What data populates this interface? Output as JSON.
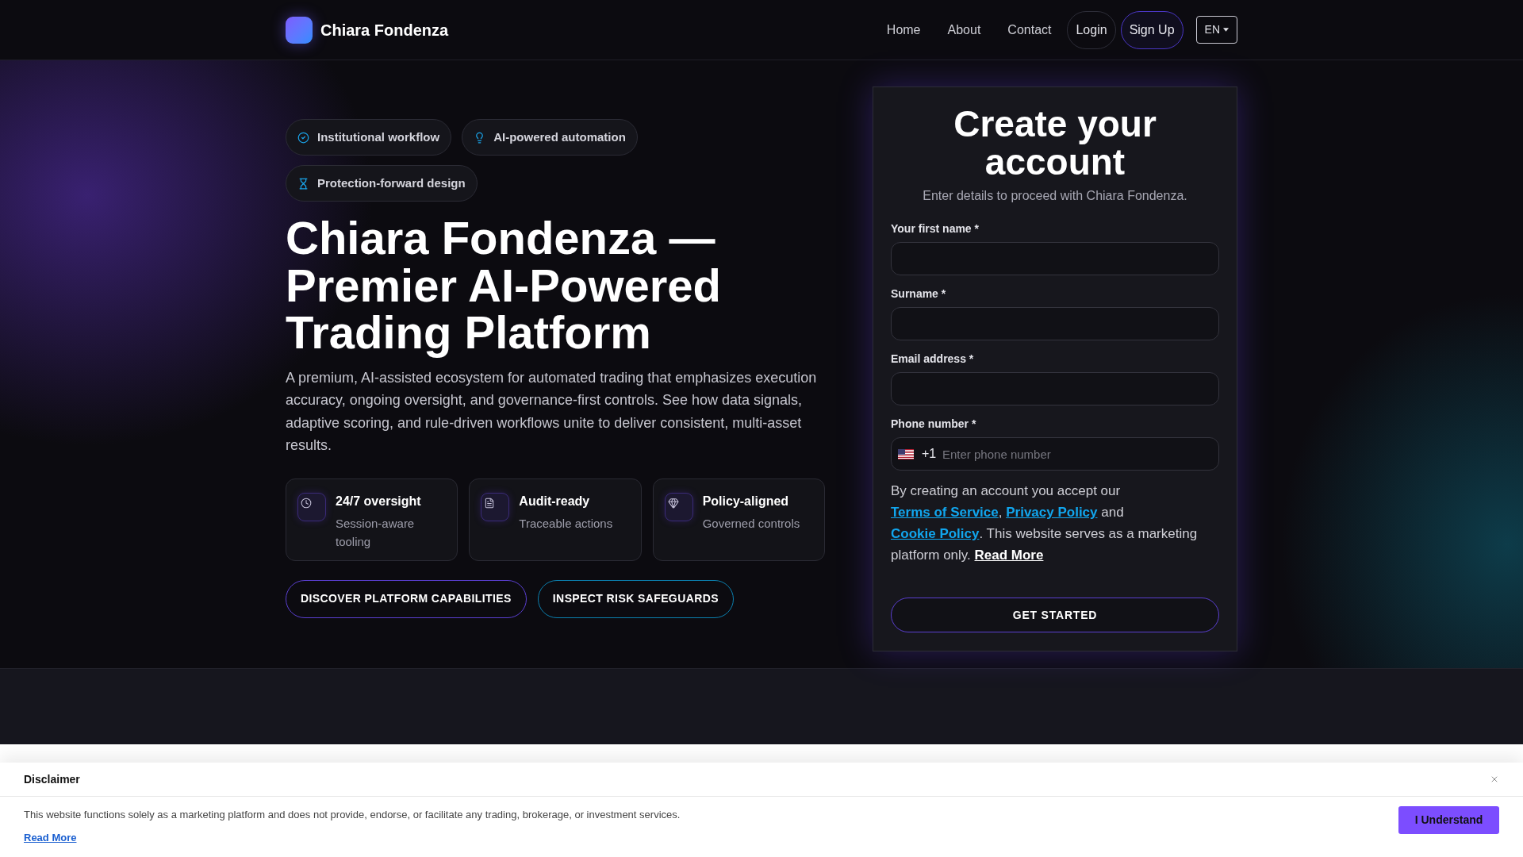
{
  "header": {
    "brand": "Chiara Fondenza",
    "nav": [
      {
        "kind": "link",
        "label": "Home"
      },
      {
        "kind": "link",
        "label": "About"
      },
      {
        "kind": "link",
        "label": "Contact"
      },
      {
        "kind": "outline",
        "label": "Login"
      },
      {
        "kind": "accent",
        "label": "Sign Up"
      }
    ],
    "language": "EN"
  },
  "hero": {
    "badges": [
      "Institutional workflow",
      "AI-powered automation",
      "Protection-forward design"
    ],
    "title": "Chiara Fondenza — Premier AI-Powered Trading Platform",
    "description": "A premium, AI-assisted ecosystem for automated trading that emphasizes execution accuracy, ongoing oversight, and governance-first controls. See how data signals, adaptive scoring, and rule-driven workflows unite to deliver consistent, multi-asset results.",
    "features": [
      {
        "title": "24/7 oversight",
        "text": "Session-aware tooling"
      },
      {
        "title": "Audit-ready",
        "text": "Traceable actions"
      },
      {
        "title": "Policy-aligned",
        "text": "Governed controls"
      }
    ],
    "actions": [
      {
        "kind": "primary",
        "label": "DISCOVER PLATFORM CAPABILITIES"
      },
      {
        "kind": "secondary",
        "label": "INSPECT RISK SAFEGUARDS"
      }
    ]
  },
  "signup": {
    "title": "Create your account",
    "subtitle": "Enter details to proceed with Chiara Fondenza.",
    "fields": [
      {
        "kind": "text",
        "label": "Your first name *"
      },
      {
        "kind": "text",
        "label": "Surname *"
      },
      {
        "kind": "email",
        "label": "Email address *"
      },
      {
        "kind": "phone",
        "label": "Phone number *",
        "dial_code": "+1",
        "placeholder": "Enter phone number"
      }
    ],
    "consent": [
      {
        "kind": "text",
        "text": "By creating an account you accept our "
      },
      {
        "kind": "link",
        "text": "Terms of Service"
      },
      {
        "kind": "text",
        "text": ", "
      },
      {
        "kind": "link",
        "text": "Privacy Policy"
      },
      {
        "kind": "text",
        "text": " and "
      },
      {
        "kind": "link",
        "text": "Cookie Policy"
      },
      {
        "kind": "text",
        "text": ". This website serves as a marketing platform only. "
      },
      {
        "kind": "more",
        "text": "Read More"
      }
    ],
    "submit": "GET STARTED"
  },
  "disclaimer": {
    "title": "Disclaimer",
    "text": "This website functions solely as a marketing platform and does not provide, endorse, or facilitate any trading, brokerage, or investment services.",
    "link": "Read More",
    "button": "I Understand"
  }
}
